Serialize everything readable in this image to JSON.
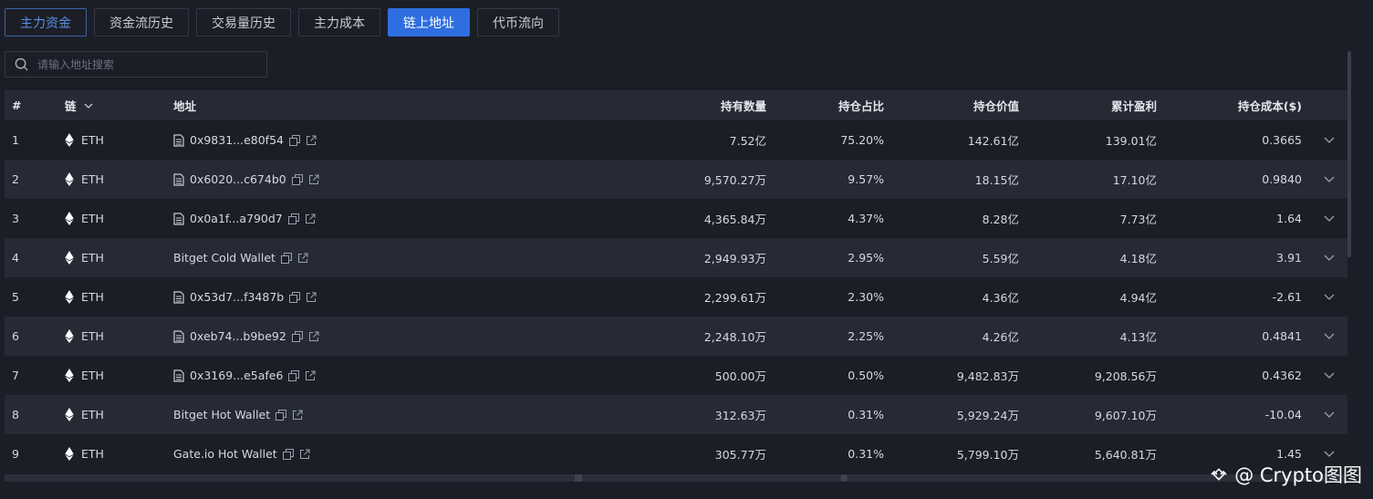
{
  "tabs": [
    {
      "label": "主力资金"
    },
    {
      "label": "资金流历史"
    },
    {
      "label": "交易量历史"
    },
    {
      "label": "主力成本"
    },
    {
      "label": "链上地址"
    },
    {
      "label": "代币流向"
    }
  ],
  "search": {
    "placeholder": "请输入地址搜索"
  },
  "table": {
    "headers": {
      "num": "#",
      "chain": "链",
      "address": "地址",
      "holdings": "持有数量",
      "ratio": "持仓占比",
      "value": "持仓价值",
      "pnl": "累计盈利",
      "cost": "持仓成本($)"
    },
    "rows": [
      {
        "num": "1",
        "chain": "ETH",
        "address": "0x9831...e80f54",
        "holdings": "7.52亿",
        "ratio": "75.20%",
        "value": "142.61亿",
        "pnl": "139.01亿",
        "cost": "0.3665"
      },
      {
        "num": "2",
        "chain": "ETH",
        "address": "0x6020...c674b0",
        "holdings": "9,570.27万",
        "ratio": "9.57%",
        "value": "18.15亿",
        "pnl": "17.10亿",
        "cost": "0.9840"
      },
      {
        "num": "3",
        "chain": "ETH",
        "address": "0x0a1f...a790d7",
        "holdings": "4,365.84万",
        "ratio": "4.37%",
        "value": "8.28亿",
        "pnl": "7.73亿",
        "cost": "1.64"
      },
      {
        "num": "4",
        "chain": "ETH",
        "address": "Bitget Cold Wallet",
        "holdings": "2,949.93万",
        "ratio": "2.95%",
        "value": "5.59亿",
        "pnl": "4.18亿",
        "cost": "3.91"
      },
      {
        "num": "5",
        "chain": "ETH",
        "address": "0x53d7...f3487b",
        "holdings": "2,299.61万",
        "ratio": "2.30%",
        "value": "4.36亿",
        "pnl": "4.94亿",
        "cost": "-2.61"
      },
      {
        "num": "6",
        "chain": "ETH",
        "address": "0xeb74...b9be92",
        "holdings": "2,248.10万",
        "ratio": "2.25%",
        "value": "4.26亿",
        "pnl": "4.13亿",
        "cost": "0.4841"
      },
      {
        "num": "7",
        "chain": "ETH",
        "address": "0x3169...e5afe6",
        "holdings": "500.00万",
        "ratio": "0.50%",
        "value": "9,482.83万",
        "pnl": "9,208.56万",
        "cost": "0.4362"
      },
      {
        "num": "8",
        "chain": "ETH",
        "address": "Bitget Hot Wallet",
        "holdings": "312.63万",
        "ratio": "0.31%",
        "value": "5,929.24万",
        "pnl": "9,607.10万",
        "cost": "-10.04"
      },
      {
        "num": "9",
        "chain": "ETH",
        "address": "Gate.io Hot Wallet",
        "holdings": "305.77万",
        "ratio": "0.31%",
        "value": "5,799.10万",
        "pnl": "5,640.81万",
        "cost": "1.45"
      }
    ]
  },
  "contract_rows": [
    0,
    1,
    2,
    4,
    5,
    6
  ],
  "watermark": {
    "text": "@ Crypto图图"
  }
}
